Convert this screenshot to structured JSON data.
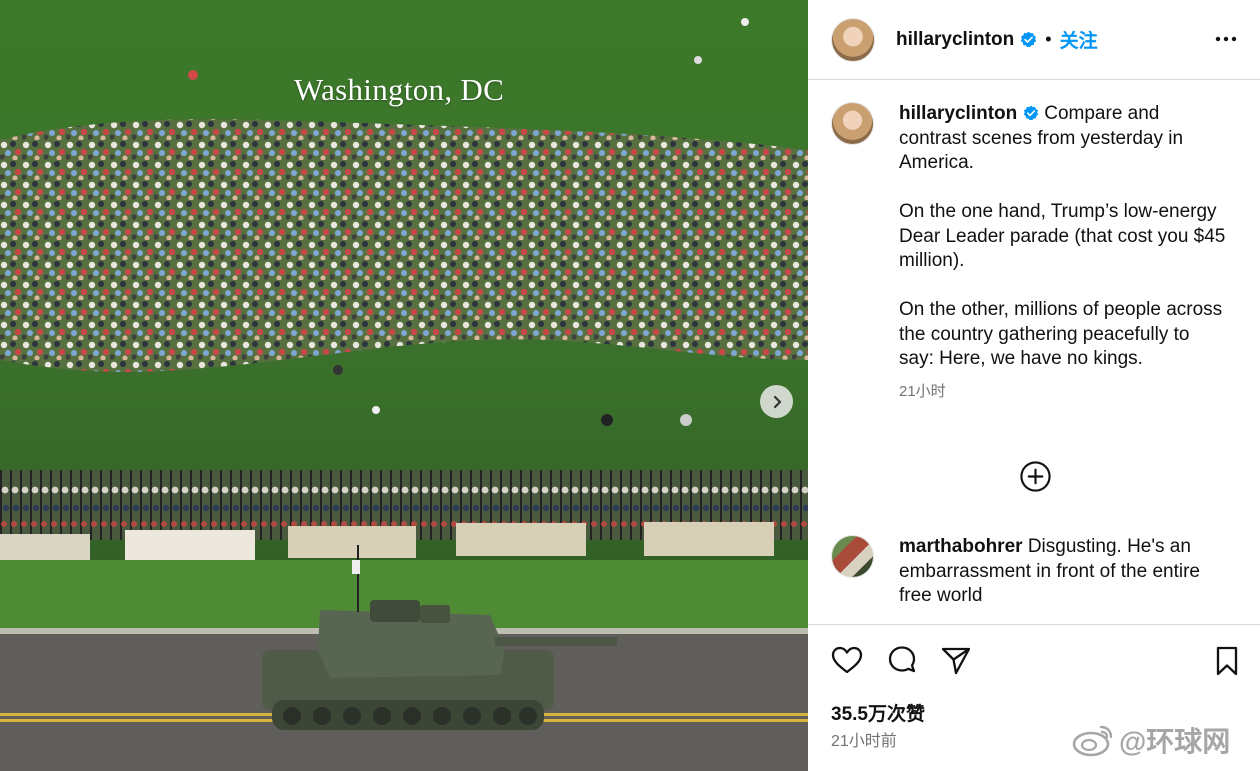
{
  "media": {
    "overlay_text": "Washington, DC",
    "next_button_icon": "chevron-right-icon"
  },
  "header": {
    "username": "hillaryclinton",
    "verified_icon": "verified-badge-icon",
    "separator": "•",
    "follow_label": "关注",
    "more_icon": "more-horizontal-icon"
  },
  "caption": {
    "username": "hillaryclinton",
    "text": "Compare and contrast scenes from yesterday in America.\n\nOn the one hand, Trump’s low-energy Dear Leader parade (that cost you $45 million).\n\nOn the other, millions of people across the country gathering peacefully to say: Here, we have no kings.",
    "time": "21小时"
  },
  "load_more_icon": "plus-circle-icon",
  "comments": [
    {
      "username": "marthabohrer",
      "text": "Disgusting. He's an embarrassment in front of the entire free world"
    }
  ],
  "actions": {
    "like_icon": "heart-icon",
    "comment_icon": "comment-icon",
    "share_icon": "send-icon",
    "save_icon": "bookmark-icon"
  },
  "likes": "35.5万次赞",
  "post_time": "21小时前",
  "watermark": "@环球网",
  "colors": {
    "accent_blue": "#0095f6",
    "secondary_text": "#737373",
    "divider": "#dbdbdb",
    "grass": "#3f6a2c"
  }
}
